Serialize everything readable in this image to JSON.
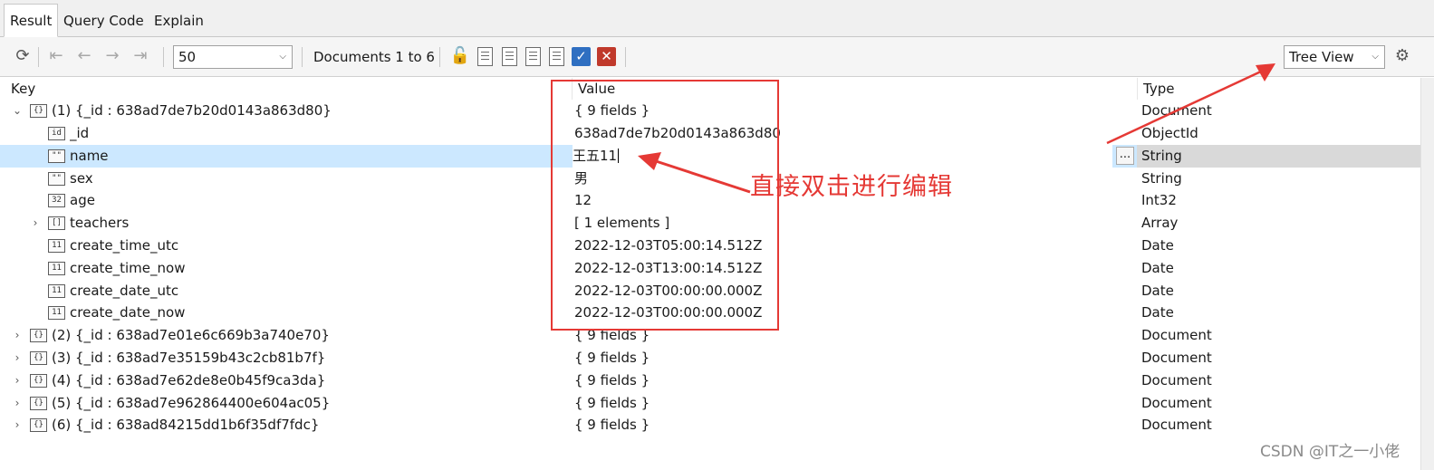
{
  "tabs": [
    {
      "label": "Result",
      "active": true
    },
    {
      "label": "Query Code",
      "active": false
    },
    {
      "label": "Explain",
      "active": false
    }
  ],
  "toolbar": {
    "page_size": "50",
    "documents_label": "Documents 1 to 6",
    "view_mode": "Tree View",
    "icons": [
      "refresh-icon",
      "first-page-icon",
      "prev-page-icon",
      "next-page-icon",
      "last-page-icon",
      "lock-icon",
      "add-document-icon",
      "clone-document-icon",
      "edit-document-icon",
      "view-document-icon",
      "validate-icon",
      "delete-icon",
      "settings-icon"
    ]
  },
  "columns": {
    "key": "Key",
    "value": "Value",
    "type": "Type"
  },
  "rows": [
    {
      "key": "(1) {_id : 638ad7de7b20d0143a863d80}",
      "value": "{ 9 fields }",
      "type": "Document",
      "icon": "{}",
      "expanded": true
    },
    {
      "key": "_id",
      "value": "638ad7de7b20d0143a863d80",
      "type": "ObjectId",
      "icon": "id"
    },
    {
      "key": "name",
      "value": "王五11",
      "type": "String",
      "icon": "\"\"",
      "selected": true
    },
    {
      "key": "sex",
      "value": "男",
      "type": "String",
      "icon": "\"\""
    },
    {
      "key": "age",
      "value": "12",
      "type": "Int32",
      "icon": "32"
    },
    {
      "key": "teachers",
      "value": "[ 1 elements ]",
      "type": "Array",
      "icon": "[]",
      "expanded": false
    },
    {
      "key": "create_time_utc",
      "value": "2022-12-03T05:00:14.512Z",
      "type": "Date",
      "icon": "11"
    },
    {
      "key": "create_time_now",
      "value": "2022-12-03T13:00:14.512Z",
      "type": "Date",
      "icon": "11"
    },
    {
      "key": "create_date_utc",
      "value": "2022-12-03T00:00:00.000Z",
      "type": "Date",
      "icon": "11"
    },
    {
      "key": "create_date_now",
      "value": "2022-12-03T00:00:00.000Z",
      "type": "Date",
      "icon": "11"
    },
    {
      "key": "(2) {_id : 638ad7e01e6c669b3a740e70}",
      "value": "{ 9 fields }",
      "type": "Document",
      "icon": "{}",
      "expanded": false
    },
    {
      "key": "(3) {_id : 638ad7e35159b43c2cb81b7f}",
      "value": "{ 9 fields }",
      "type": "Document",
      "icon": "{}",
      "expanded": false
    },
    {
      "key": "(4) {_id : 638ad7e62de8e0b45f9ca3da}",
      "value": "{ 9 fields }",
      "type": "Document",
      "icon": "{}",
      "expanded": false
    },
    {
      "key": "(5) {_id : 638ad7e962864400e604ac05}",
      "value": "{ 9 fields }",
      "type": "Document",
      "icon": "{}",
      "expanded": false
    },
    {
      "key": "(6) {_id : 638ad84215dd1b6f35df7fdc}",
      "value": "{ 9 fields }",
      "type": "Document",
      "icon": "{}",
      "expanded": false
    }
  ],
  "editor": {
    "ellipsis": "..."
  },
  "annotation": {
    "text": "直接双击进行编辑",
    "color": "#e53935"
  },
  "watermark": "CSDN @IT之一小佬"
}
